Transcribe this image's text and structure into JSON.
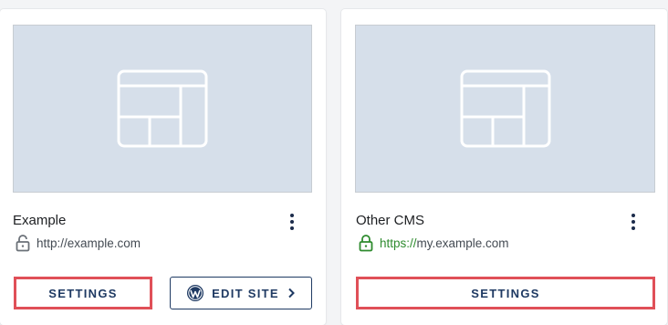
{
  "sites": [
    {
      "name": "Example",
      "url": "http://example.com",
      "secure": false,
      "settings_label": "SETTINGS",
      "edit_label": "EDIT SITE",
      "lock_icon": "lock-open-icon"
    },
    {
      "name": "Other CMS",
      "url_scheme": "https://",
      "url_rest": "my.example.com",
      "secure": true,
      "settings_label": "SETTINGS",
      "lock_icon": "lock-closed-icon"
    }
  ],
  "colors": {
    "primary": "#1f3a63",
    "highlight": "#e05058",
    "secure_green": "#2e8b2e",
    "thumb_bg": "#d6dfea"
  }
}
